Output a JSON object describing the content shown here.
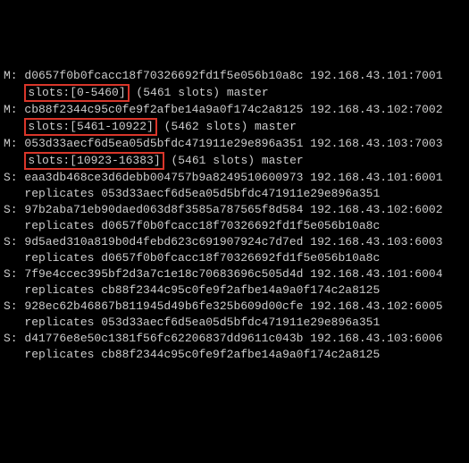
{
  "nodes": [
    {
      "role": "M",
      "id": "d0657f0b0fcacc18f70326692fd1f5e056b10a8c",
      "addr": "192.168.43.101:7001",
      "slots_box": "slots:[0-5460]",
      "slots_tail": " (5461 slots) master"
    },
    {
      "role": "M",
      "id": "cb88f2344c95c0fe9f2afbe14a9a0f174c2a8125",
      "addr": "192.168.43.102:7002",
      "slots_box": "slots:[5461-10922]",
      "slots_tail": " (5462 slots) master"
    },
    {
      "role": "M",
      "id": "053d33aecf6d5ea05d5bfdc471911e29e896a351",
      "addr": "192.168.43.103:7003",
      "slots_box": "slots:[10923-16383]",
      "slots_tail": " (5461 slots) master"
    },
    {
      "role": "S",
      "id": "eaa3db468ce3d6debb004757b9a8249510600973",
      "addr": "192.168.43.101:6001",
      "replicates": "053d33aecf6d5ea05d5bfdc471911e29e896a351"
    },
    {
      "role": "S",
      "id": "97b2aba71eb90daed063d8f3585a787565f8d584",
      "addr": "192.168.43.102:6002",
      "replicates": "d0657f0b0fcacc18f70326692fd1f5e056b10a8c"
    },
    {
      "role": "S",
      "id": "9d5aed310a819b0d4febd623c691907924c7d7ed",
      "addr": "192.168.43.103:6003",
      "replicates": "d0657f0b0fcacc18f70326692fd1f5e056b10a8c"
    },
    {
      "role": "S",
      "id": "7f9e4ccec395bf2d3a7c1e18c70683696c505d4d",
      "addr": "192.168.43.101:6004",
      "replicates": "cb88f2344c95c0fe9f2afbe14a9a0f174c2a8125"
    },
    {
      "role": "S",
      "id": "928ec62b46867b811945d49b6fe325b609d00cfe",
      "addr": "192.168.43.102:6005",
      "replicates": "053d33aecf6d5ea05d5bfdc471911e29e896a351"
    },
    {
      "role": "S",
      "id": "d41776e8e50c1381f56fc62206837dd9611c043b",
      "addr": "192.168.43.103:6006",
      "replicates": "cb88f2344c95c0fe9f2afbe14a9a0f174c2a8125"
    }
  ],
  "labels": {
    "replicates": "replicates"
  }
}
